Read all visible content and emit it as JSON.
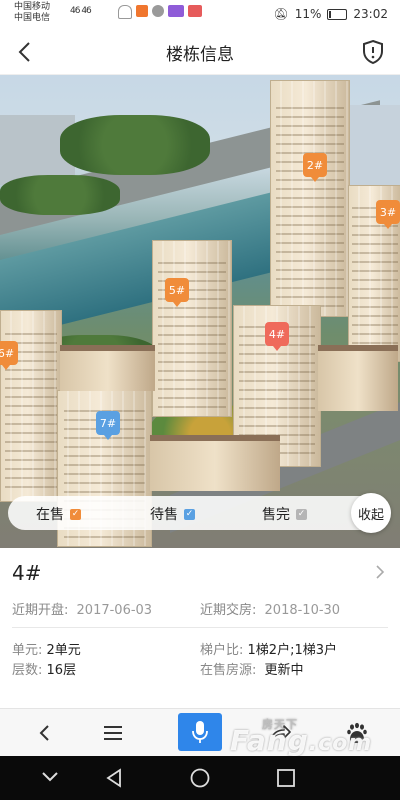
{
  "status_bar": {
    "carrier1": "中国移动",
    "carrier2": "中国电信",
    "signal_text": "46 46",
    "battery": "11%",
    "time": "23:02"
  },
  "header": {
    "title": "楼栋信息"
  },
  "hero": {
    "building_tags": [
      {
        "label": "2#",
        "status": "在售"
      },
      {
        "label": "3#",
        "status": "在售"
      },
      {
        "label": "5#",
        "status": "在售"
      },
      {
        "label": "4#",
        "status": "selected"
      },
      {
        "label": "6#",
        "status": "在售"
      },
      {
        "label": "7#",
        "status": "待售"
      }
    ],
    "legend": [
      {
        "label": "在售",
        "color": "#f08c3a"
      },
      {
        "label": "待售",
        "color": "#5aa0e2"
      },
      {
        "label": "售完",
        "color": "#b5b5b5"
      }
    ],
    "collapse_label": "收起"
  },
  "building": {
    "name": "4#",
    "open_date_label": "近期开盘:",
    "open_date": "2017-06-03",
    "delivery_label": "近期交房:",
    "delivery_date": "2018-10-30",
    "unit_label": "单元:",
    "unit_value": "2单元",
    "elevator_label": "梯户比:",
    "elevator_value": "1梯2户;1梯3户",
    "floors_label": "层数:",
    "floors_value": "16层",
    "on_sale_label": "在售房源:",
    "on_sale_value": "更新中"
  },
  "toolbar": {
    "items": [
      "back-icon",
      "menu-icon",
      "mic-icon",
      "share-icon",
      "baidu-paw-icon"
    ],
    "accent": "#2f86ea"
  },
  "watermark": {
    "text": "Fang",
    "suffix": ".com",
    "small": "房天下"
  }
}
